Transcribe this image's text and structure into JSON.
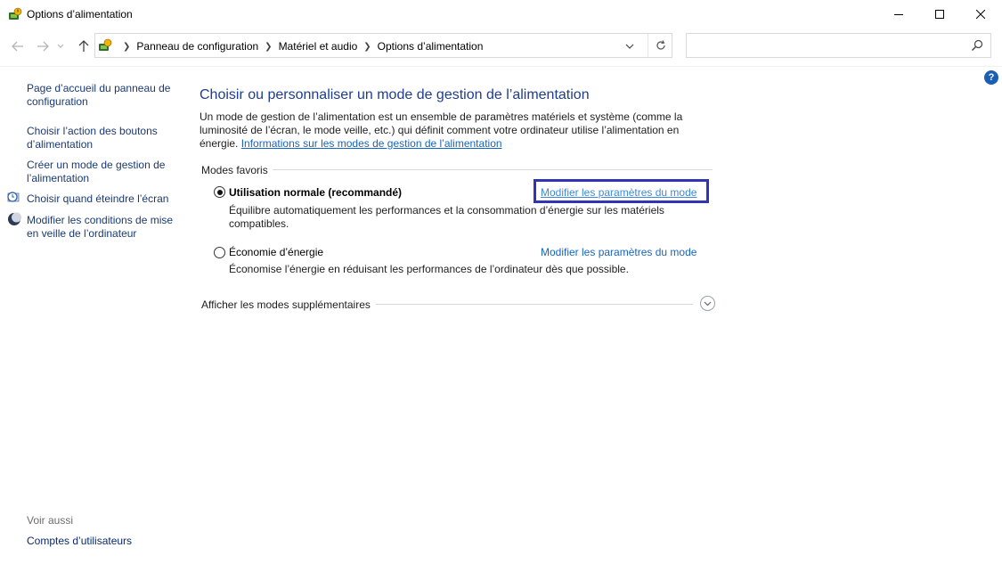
{
  "window": {
    "title": "Options d’alimentation"
  },
  "address": {
    "crumbs": [
      "Panneau de configuration",
      "Matériel et audio",
      "Options d’alimentation"
    ],
    "search_placeholder": ""
  },
  "help": {
    "label": "?"
  },
  "sidebar": {
    "links": [
      {
        "label": "Page d’accueil du panneau de configuration"
      },
      {
        "label": "Choisir l’action des boutons d’alimentation"
      },
      {
        "label": "Créer un mode de gestion de l’alimentation"
      },
      {
        "label": "Choisir quand éteindre l’écran",
        "icon": "screen-clock-icon"
      },
      {
        "label": "Modifier les conditions de mise en veille de l’ordinateur",
        "icon": "moon-icon"
      }
    ],
    "see_also": {
      "heading": "Voir aussi",
      "links": [
        {
          "label": "Comptes d’utilisateurs"
        }
      ]
    }
  },
  "main": {
    "title": "Choisir ou personnaliser un mode de gestion de l’alimentation",
    "intro_text": "Un mode de gestion de l’alimentation est un ensemble de paramètres matériels et système (comme la luminosité de l’écran, le mode veille, etc.) qui définit comment votre ordinateur utilise l’alimentation en énergie.",
    "intro_link": "Informations sur les modes de gestion de l’alimentation",
    "section_label": "Modes favoris",
    "plans": [
      {
        "name": "Utilisation normale (recommandé)",
        "selected": true,
        "description": "Équilibre automatiquement les performances et la consommation d’énergie sur les matériels compatibles.",
        "link": "Modifier les paramètres du mode"
      },
      {
        "name": "Économie d’énergie",
        "selected": false,
        "description": "Économise l’énergie en réduisant les performances de l’ordinateur dès que possible.",
        "link": "Modifier les paramètres du mode"
      }
    ],
    "more_plans_label": "Afficher les modes supplémentaires"
  },
  "colors": {
    "accent_link": "#1565c0",
    "title_blue": "#1e3d8f",
    "highlight_box": "#2f35b5"
  }
}
